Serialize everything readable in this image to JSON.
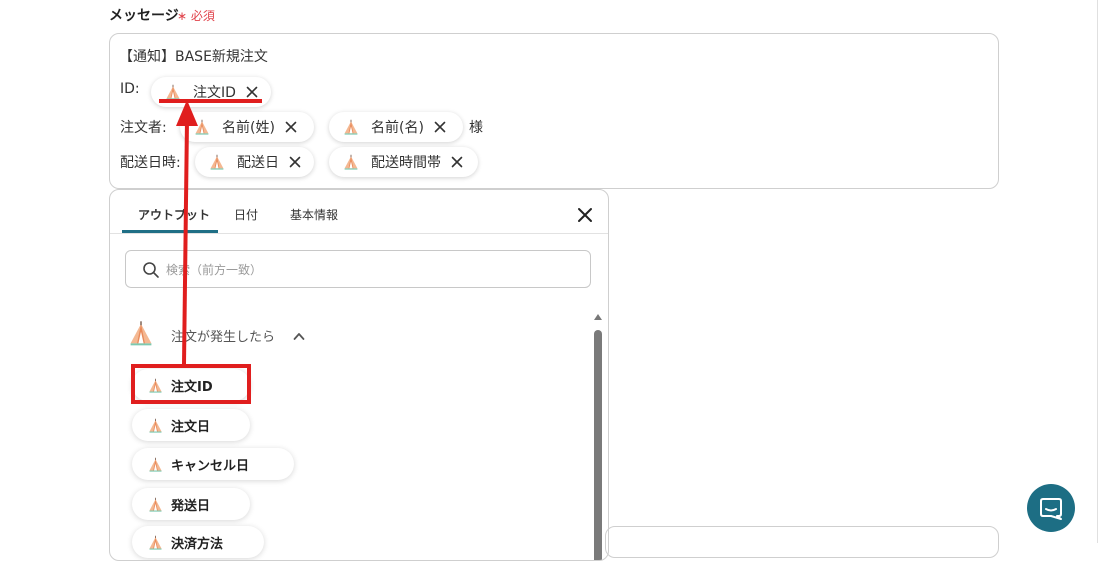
{
  "field": {
    "label": "メッセージ",
    "required_mark": "∗",
    "required_text": "必須"
  },
  "message": {
    "line1": "【通知】BASE新規注文",
    "id_label": "ID:",
    "orderer_label": "注文者:",
    "orderer_suffix": "様",
    "delivery_label": "配送日時:",
    "chips": {
      "order_id": "注文ID",
      "last_name": "名前(姓)",
      "first_name": "名前(名)",
      "delivery_date": "配送日",
      "delivery_time": "配送時間帯"
    }
  },
  "panel": {
    "tabs": [
      "アウトプット",
      "日付",
      "基本情報"
    ],
    "active_tab": 0,
    "search_placeholder": "検索（前方一致）",
    "group_title": "注文が発生したら",
    "items": [
      "注文ID",
      "注文日",
      "キャンセル日",
      "発送日",
      "決済方法"
    ]
  },
  "colors": {
    "accent": "#1f6f86",
    "required": "#e0434b",
    "highlight": "#e01e1e",
    "chat_button": "#1d6e84"
  },
  "icons": {
    "tent": "base-tent-icon",
    "remove": "close-x-icon",
    "panel_close": "close-icon",
    "search": "search-icon",
    "collapse": "chevron-up-icon",
    "chat": "chat-icon"
  }
}
